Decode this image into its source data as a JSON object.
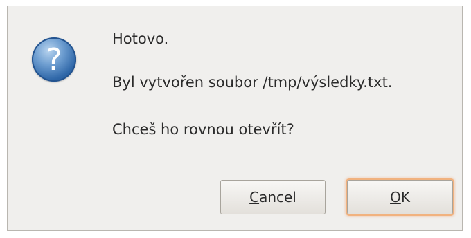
{
  "dialog": {
    "icon": "question-icon",
    "heading": "Hotovo.",
    "message": "Byl vytvořen soubor /tmp/výsledky.txt.",
    "question": "Chceš ho rovnou otevřít?",
    "buttons": {
      "cancel": {
        "mnemonic": "C",
        "rest": "ancel"
      },
      "ok": {
        "mnemonic": "O",
        "rest": "K"
      }
    },
    "colors": {
      "background": "#f0efed",
      "icon": "#2f67a8",
      "focus_ring": "#f1b27f"
    }
  }
}
